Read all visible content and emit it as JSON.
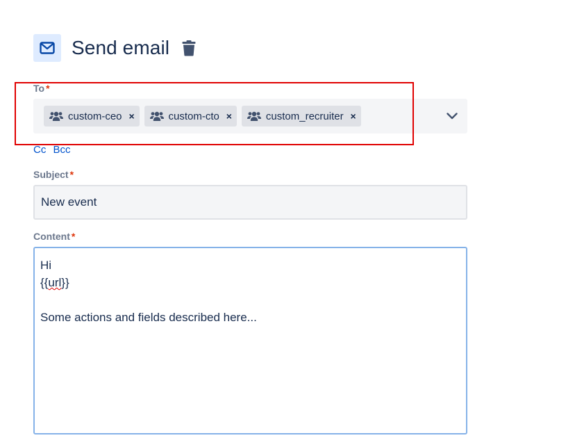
{
  "header": {
    "title": "Send email",
    "icon": "mail-icon",
    "delete_icon": "trash-icon"
  },
  "to": {
    "label": "To",
    "required_mark": "*",
    "recipients": [
      {
        "label": "custom-ceo",
        "icon": "group-icon"
      },
      {
        "label": "custom-cto",
        "icon": "group-icon"
      },
      {
        "label": "custom_recruiter",
        "icon": "group-icon"
      }
    ],
    "remove_glyph": "×",
    "dropdown_icon": "chevron-down-icon"
  },
  "cc_label": "Cc",
  "bcc_label": "Bcc",
  "subject": {
    "label": "Subject",
    "required_mark": "*",
    "value": "New event"
  },
  "content": {
    "label": "Content",
    "required_mark": "*",
    "lines": {
      "l1": "Hi",
      "l2_pre": "{{",
      "l2_word": "url",
      "l2_post": "}}",
      "l3": "",
      "l4": "Some actions and fields described here..."
    }
  },
  "colors": {
    "accent": "#0052cc",
    "required": "#de350b",
    "highlight": "#e00000",
    "field_bg": "#f4f5f7",
    "chip_bg": "#dfe1e6"
  }
}
